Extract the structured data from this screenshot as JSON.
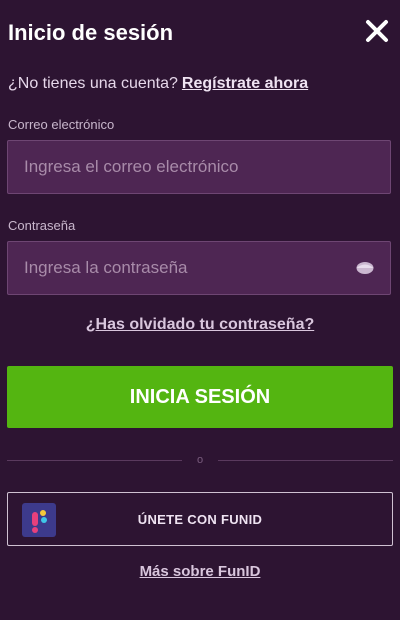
{
  "header": {
    "title": "Inicio de sesión",
    "close_icon": "close-icon"
  },
  "signup": {
    "prompt": "¿No tienes una cuenta?",
    "link_label": "Regístrate ahora"
  },
  "email": {
    "label": "Correo electrónico",
    "placeholder": "Ingresa el correo electrónico",
    "value": ""
  },
  "password": {
    "label": "Contraseña",
    "placeholder": "Ingresa la contraseña",
    "value": "",
    "toggle_icon": "eye-icon"
  },
  "forgot_password": {
    "label": "¿Has olvidado tu contraseña?"
  },
  "login_button": {
    "label": "INICIA SESIÓN"
  },
  "divider": {
    "label": "o"
  },
  "funid": {
    "button_label": "ÚNETE CON FUNID",
    "more_label": "Más sobre FunID",
    "logo_icon": "funid-logo-icon"
  },
  "colors": {
    "background": "#2d1432",
    "input_bg": "#4e2653",
    "primary_green": "#54b511",
    "text": "#ffffff"
  }
}
